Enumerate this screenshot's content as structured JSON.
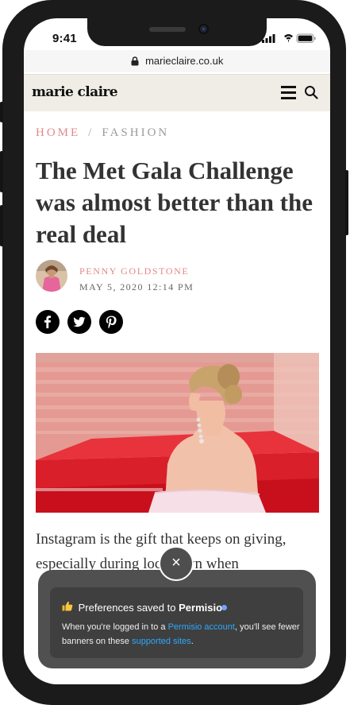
{
  "status_bar": {
    "time": "9:41"
  },
  "browser": {
    "url": "marieclaire.co.uk"
  },
  "header": {
    "logo": "marie claire",
    "menu_icon": "hamburger-menu-icon",
    "search_icon": "search-icon"
  },
  "breadcrumb": {
    "home": "HOME",
    "separator": "/",
    "section": "FASHION"
  },
  "article": {
    "title": "The Met Gala Challenge was almost better than the real deal",
    "author": "PENNY GOLDSTONE",
    "date": "MAY 5, 2020 12:14 PM",
    "share_icons": [
      "facebook-icon",
      "twitter-icon",
      "pinterest-icon"
    ],
    "body_line_1": "Instagram is the gift that keeps on giving,",
    "body_line_2": "especially during lockdown when"
  },
  "toast": {
    "close_label": "×",
    "title_prefix": "Preferences saved to",
    "title_brand": "Permisio",
    "body_prefix": "When you're logged in to a",
    "account_link": "Permisio account",
    "body_middle": ", you'll see fewer banners on these",
    "sites_link": "supported sites",
    "body_suffix": "."
  },
  "colors": {
    "accent_pink": "#e0888a",
    "header_bg": "#efede5",
    "toast_bg": "#505050",
    "link_blue": "#2ea8ff"
  }
}
